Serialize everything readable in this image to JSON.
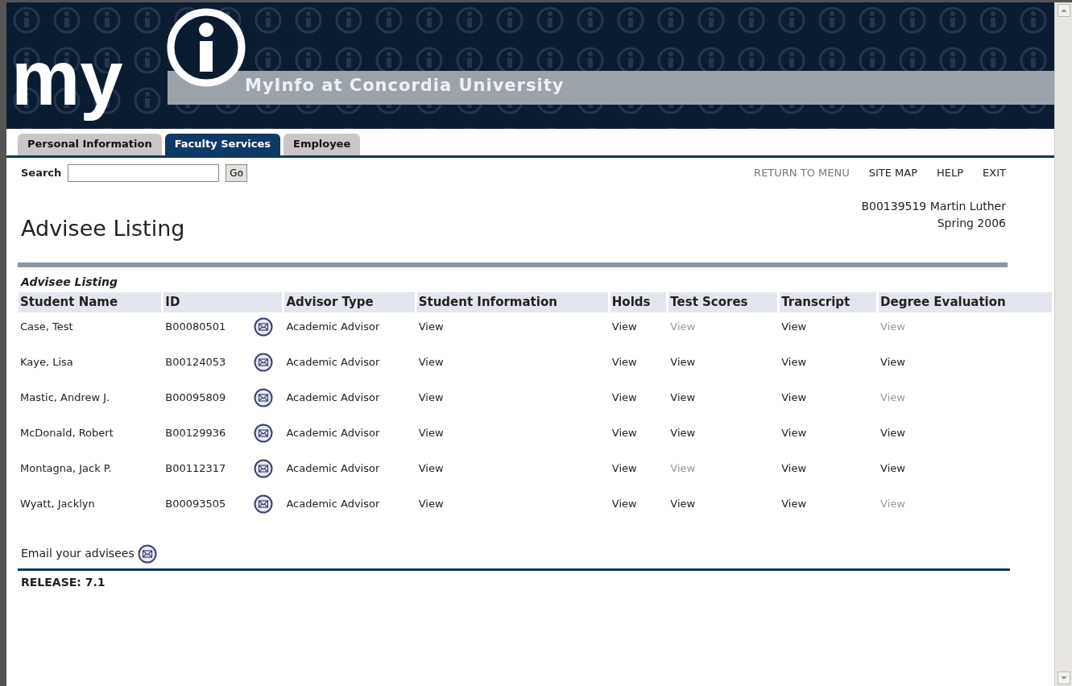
{
  "header": {
    "logo": "my",
    "title": "MyInfo at Concordia University"
  },
  "tabs": [
    {
      "label": "Personal Information",
      "selected": false
    },
    {
      "label": "Faculty Services",
      "selected": true
    },
    {
      "label": "Employee",
      "selected": false
    }
  ],
  "search": {
    "label": "Search",
    "button": "Go"
  },
  "top_links": [
    {
      "label": "RETURN TO MENU",
      "disabled": true
    },
    {
      "label": "SITE MAP",
      "disabled": false
    },
    {
      "label": "HELP",
      "disabled": false
    },
    {
      "label": "EXIT",
      "disabled": false
    }
  ],
  "page_title": "Advisee Listing",
  "user": {
    "line1": "B00139519 Martin Luther",
    "term": "Spring 2006"
  },
  "table": {
    "caption": "Advisee Listing",
    "columns": [
      "Student Name",
      "ID",
      "Advisor Type",
      "Student Information",
      "Holds",
      "Test Scores",
      "Transcript",
      "Degree Evaluation"
    ],
    "rows": [
      {
        "name": "Case, Test",
        "id": "B00080501",
        "advisor_type": "Academic Advisor",
        "links": [
          {
            "label": "View",
            "disabled": false
          },
          {
            "label": "View",
            "disabled": false
          },
          {
            "label": "View",
            "disabled": true
          },
          {
            "label": "View",
            "disabled": false
          },
          {
            "label": "View",
            "disabled": true
          }
        ]
      },
      {
        "name": "Kaye, Lisa",
        "id": "B00124053",
        "advisor_type": "Academic Advisor",
        "links": [
          {
            "label": "View",
            "disabled": false
          },
          {
            "label": "View",
            "disabled": false
          },
          {
            "label": "View",
            "disabled": false
          },
          {
            "label": "View",
            "disabled": false
          },
          {
            "label": "View",
            "disabled": false
          }
        ]
      },
      {
        "name": "Mastic, Andrew J.",
        "id": "B00095809",
        "advisor_type": "Academic Advisor",
        "links": [
          {
            "label": "View",
            "disabled": false
          },
          {
            "label": "View",
            "disabled": false
          },
          {
            "label": "View",
            "disabled": false
          },
          {
            "label": "View",
            "disabled": false
          },
          {
            "label": "View",
            "disabled": true
          }
        ]
      },
      {
        "name": "McDonald, Robert",
        "id": "B00129936",
        "advisor_type": "Academic Advisor",
        "links": [
          {
            "label": "View",
            "disabled": false
          },
          {
            "label": "View",
            "disabled": false
          },
          {
            "label": "View",
            "disabled": false
          },
          {
            "label": "View",
            "disabled": false
          },
          {
            "label": "View",
            "disabled": false
          }
        ]
      },
      {
        "name": "Montagna, Jack P.",
        "id": "B00112317",
        "advisor_type": "Academic Advisor",
        "links": [
          {
            "label": "View",
            "disabled": false
          },
          {
            "label": "View",
            "disabled": false
          },
          {
            "label": "View",
            "disabled": true
          },
          {
            "label": "View",
            "disabled": false
          },
          {
            "label": "View",
            "disabled": false
          }
        ]
      },
      {
        "name": "Wyatt, Jacklyn",
        "id": "B00093505",
        "advisor_type": "Academic Advisor",
        "links": [
          {
            "label": "View",
            "disabled": false
          },
          {
            "label": "View",
            "disabled": false
          },
          {
            "label": "View",
            "disabled": false
          },
          {
            "label": "View",
            "disabled": false
          },
          {
            "label": "View",
            "disabled": true
          }
        ]
      }
    ]
  },
  "email_link": "Email your advisees",
  "release": "RELEASE: 7.1"
}
